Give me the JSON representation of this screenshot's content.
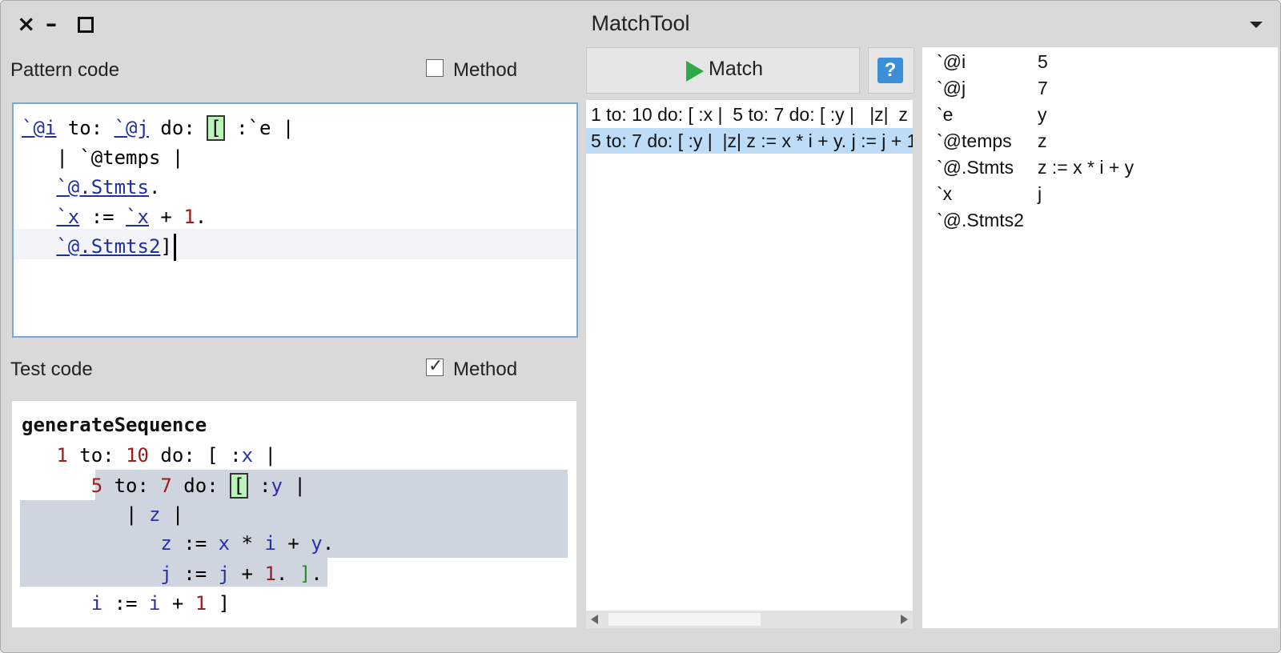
{
  "window": {
    "title": "MatchTool",
    "close": "×",
    "minimize": "–"
  },
  "pattern": {
    "label": "Pattern code",
    "method_label": "Method",
    "method_checked": false
  },
  "test": {
    "label": "Test code",
    "method_label": "Method",
    "method_checked": true,
    "method_name": "generateSequence"
  },
  "toolbar": {
    "match_label": "Match",
    "help_label": "?"
  },
  "matches": [
    "1 to: 10 do: [ :x |  5 to: 7 do: [ :y |   |z|  z",
    "5 to: 7 do: [ :y |  |z| z := x * i + y. j := j + 1"
  ],
  "bindings": [
    {
      "name": "`@i",
      "value": "5"
    },
    {
      "name": "`@j",
      "value": "7"
    },
    {
      "name": "`e",
      "value": "y"
    },
    {
      "name": "`@temps",
      "value": "z"
    },
    {
      "name": "`@.Stmts",
      "value": "z := x * i + y"
    },
    {
      "name": "`x",
      "value": "j"
    },
    {
      "name": "`@.Stmts2",
      "value": ""
    }
  ],
  "colors": {
    "accent_selection": "#bcdcf8",
    "match_highlight": "#cfd5de",
    "play_icon": "#2fa846",
    "help_icon": "#3b8fd8"
  }
}
